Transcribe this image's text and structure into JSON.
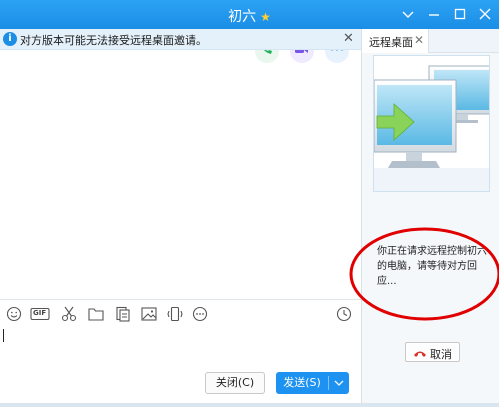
{
  "titlebar": {
    "title": "初六",
    "star_color": "#ffcf33"
  },
  "window_controls": [
    "chevron-down-icon",
    "minimize-icon",
    "maximize-icon",
    "close-icon"
  ],
  "notice": {
    "text": "对方版本可能无法接受远程桌面邀请。",
    "icon": "info-icon",
    "close": "✕"
  },
  "call_buttons": [
    "voice-call-icon",
    "video-call-icon",
    "more-icon"
  ],
  "toolbar": {
    "gif_label": "GIF",
    "icons": [
      "emoji-icon",
      "gif-icon",
      "screenshot-icon",
      "folder-icon",
      "file-icon",
      "image-icon",
      "shake-icon",
      "more-icon",
      "history-icon"
    ]
  },
  "input": {
    "value": ""
  },
  "buttons": {
    "close_label": "关闭(C)",
    "send_label": "发送(S)"
  },
  "side_panel": {
    "tab_label": "远程桌面",
    "tab_close": "✕",
    "status_text": "你正在请求远程控制初六的电脑，请等待对方回应...",
    "cancel_label": "取消"
  },
  "colors": {
    "title_bar": "#1e92f0",
    "accent": "#1e92f0",
    "highlight": "#e00000",
    "hangup": "#d9342b"
  }
}
